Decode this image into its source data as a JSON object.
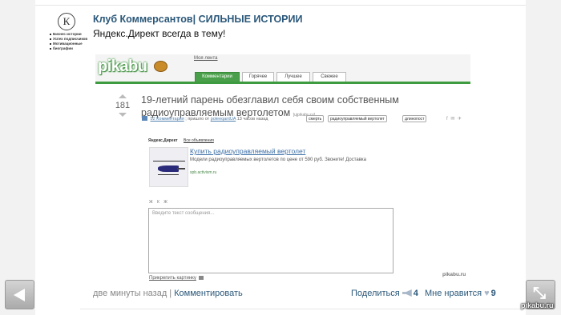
{
  "group": {
    "name": "Клуб Коммерсантов| СИЛЬНЫЕ ИСТОРИИ",
    "logo_letter": "К",
    "logo_items": [
      "Бизнес истории",
      "Успех подписчиков",
      "Мотивационные",
      "биографии"
    ]
  },
  "post": {
    "text": "Яндекс.Директ всегда в тему!"
  },
  "pikabu": {
    "logo": "pikabu",
    "my_feed": "Моя лента",
    "tabs": [
      "Комментарии",
      "Горячее",
      "Лучшее",
      "Свежее"
    ],
    "active_tab": 0,
    "score": "181",
    "title": "19-летний парень обезглавил себя своим собственным радиоуправляемым вертолетом",
    "source": "[ujpikabu.ru]",
    "comments_link": "52 Комментария",
    "meta_text": "; пришло от",
    "author": "poleeqantUA",
    "time": "13 часов назад",
    "tags": [
      "смерть",
      "радиоуправляемый вертолет",
      "длинопост"
    ],
    "share_icons": "f ✉ ✈"
  },
  "ad": {
    "label": "Яндекс.Директ",
    "all_ads": "Все объявления",
    "link": "Купить радиоуправляемый вертолет",
    "desc": "Модели радиоуправляемых вертолетов по цене от 590 руб. Звоните! Доставка",
    "url": "spb.activism.ru"
  },
  "comment_form": {
    "format": "Ж К Ж",
    "placeholder": "Введите текст сообщения...",
    "attach": "Прикрепить картинку",
    "watermark": "pikabu.ru"
  },
  "footer": {
    "time": "две минуты назад",
    "separator": "|",
    "comment": "Комментировать",
    "share": "Поделиться",
    "share_count": "4",
    "like": "Мне нравится",
    "like_count": "9"
  },
  "watermark": "pikabu.ru",
  "icons": [
    "left-arrow-icon",
    "expand-icon",
    "megaphone-icon",
    "heart-icon"
  ]
}
